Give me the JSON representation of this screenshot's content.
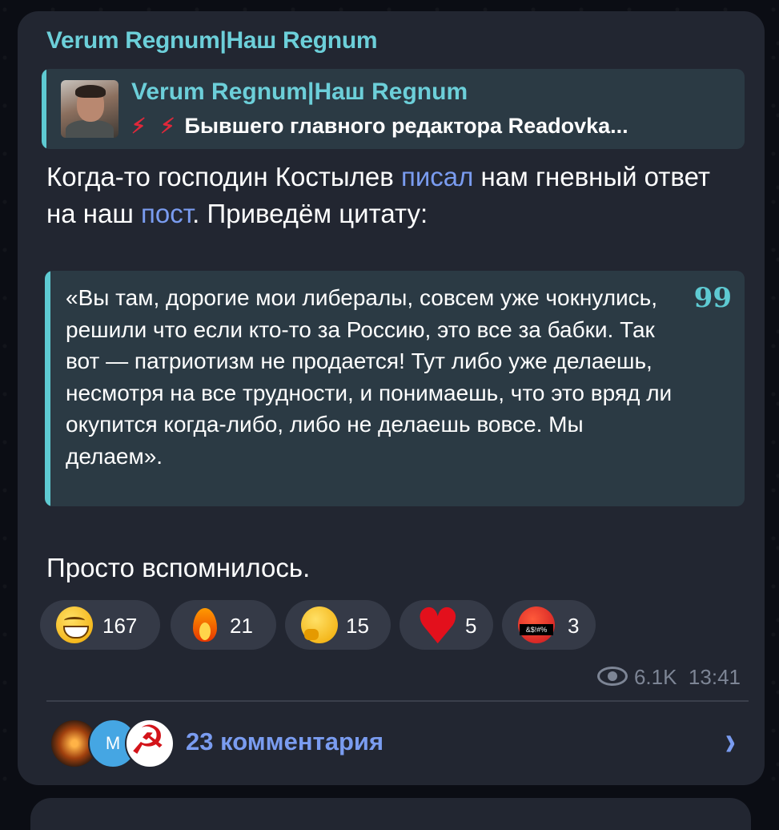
{
  "post": {
    "channel_name": "Verum Regnum|Наш Regnum",
    "reply": {
      "title": "Verum Regnum|Наш Regnum",
      "text": "Бывшего главного редактора Readovka..."
    },
    "main_text": {
      "part1": "Когда-то господин Костылев ",
      "link1": "писал",
      "part2": " нам гневный ответ на наш ",
      "link2": "пост",
      "part3": ". Приведём цитату:"
    },
    "quote": "«Вы там, дорогие мои либералы, совсем уже чокнулись, решили что если кто-то за Россию, это все за бабки. Так вот — патриотизм не продается! Тут либо уже делаешь, несмотря на все трудности, и понимаешь, что это вряд ли окупится когда-либо, либо не делаешь вовсе. Мы делаем».",
    "quote_mark": "99",
    "footer_text": "Просто вспомнилось.",
    "reactions": [
      {
        "emoji": "grinning-face",
        "count": "167"
      },
      {
        "emoji": "fire",
        "count": "21"
      },
      {
        "emoji": "thinking-face",
        "count": "15"
      },
      {
        "emoji": "red-heart",
        "count": "5"
      },
      {
        "emoji": "face-with-symbols-on-mouth",
        "count": "3"
      }
    ],
    "views": "6.1K",
    "time": "13:41",
    "commenter_initial": "M",
    "comments_label": "23 комментария"
  }
}
